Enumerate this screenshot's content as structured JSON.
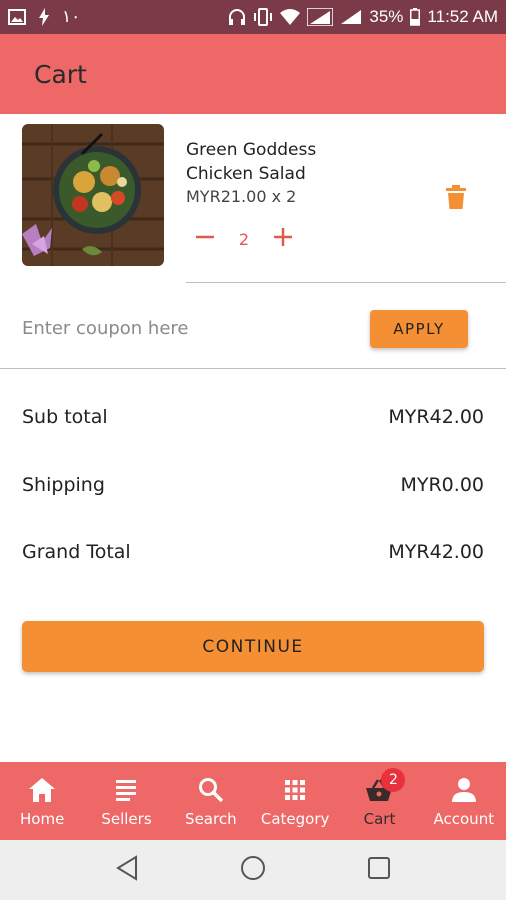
{
  "status_bar": {
    "left_text": "١٠",
    "battery": "35%",
    "time": "11:52 AM"
  },
  "app_bar": {
    "title": "Cart"
  },
  "cart_items": [
    {
      "name": "Green Goddess Chicken Salad",
      "price_line": "MYR21.00 x 2",
      "quantity": "2"
    }
  ],
  "coupon": {
    "placeholder": "Enter coupon here",
    "value": "",
    "apply_label": "APPLY"
  },
  "totals": {
    "subtotal_label": "Sub total",
    "subtotal_value": "MYR42.00",
    "shipping_label": "Shipping",
    "shipping_value": "MYR0.00",
    "grand_label": "Grand Total",
    "grand_value": "MYR42.00"
  },
  "continue_label": "CONTINUE",
  "bottom_nav": {
    "items": [
      {
        "label": "Home",
        "icon": "home-icon"
      },
      {
        "label": "Sellers",
        "icon": "list-icon"
      },
      {
        "label": "Search",
        "icon": "search-icon"
      },
      {
        "label": "Category",
        "icon": "grid-icon"
      },
      {
        "label": "Cart",
        "icon": "basket-icon",
        "badge": "2",
        "active": true
      },
      {
        "label": "Account",
        "icon": "person-icon"
      }
    ]
  },
  "colors": {
    "status_bar": "#7a3a48",
    "primary": "#ee6868",
    "accent": "#f58f33",
    "badge": "#e8313a",
    "qty_accent": "#e05a4a"
  }
}
